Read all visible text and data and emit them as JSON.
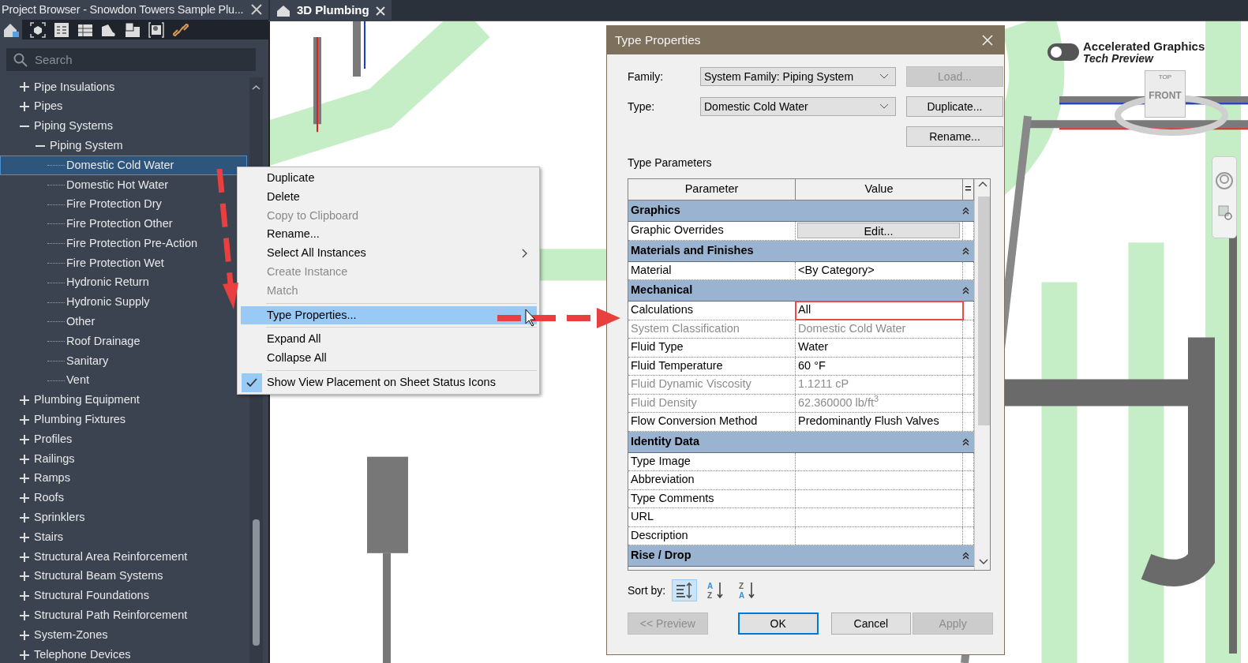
{
  "project_browser": {
    "title": "Project Browser - Snowdon Towers Sample Plu...",
    "search": {
      "placeholder": "Search"
    },
    "tree": [
      {
        "label": "Pipe Insulations",
        "kind": "group",
        "expanded": false,
        "selected": false
      },
      {
        "label": "Pipes",
        "kind": "group",
        "expanded": false,
        "selected": false
      },
      {
        "label": "Piping Systems",
        "kind": "group",
        "expanded": true,
        "selected": false,
        "children": [
          {
            "label": "Piping System",
            "kind": "group",
            "expanded": true,
            "selected": false,
            "children": [
              {
                "label": "Domestic Cold Water",
                "kind": "leaf",
                "selected": true
              },
              {
                "label": "Domestic Hot Water",
                "kind": "leaf",
                "selected": false
              },
              {
                "label": "Fire Protection Dry",
                "kind": "leaf",
                "selected": false
              },
              {
                "label": "Fire Protection Other",
                "kind": "leaf",
                "selected": false
              },
              {
                "label": "Fire Protection Pre-Action",
                "kind": "leaf",
                "selected": false
              },
              {
                "label": "Fire Protection Wet",
                "kind": "leaf",
                "selected": false
              },
              {
                "label": "Hydronic Return",
                "kind": "leaf",
                "selected": false
              },
              {
                "label": "Hydronic Supply",
                "kind": "leaf",
                "selected": false
              },
              {
                "label": "Other",
                "kind": "leaf",
                "selected": false
              },
              {
                "label": "Roof Drainage",
                "kind": "leaf",
                "selected": false
              },
              {
                "label": "Sanitary",
                "kind": "leaf",
                "selected": false
              },
              {
                "label": "Vent",
                "kind": "leaf",
                "selected": false
              }
            ]
          }
        ]
      },
      {
        "label": "Plumbing Equipment",
        "kind": "group",
        "expanded": false,
        "selected": false
      },
      {
        "label": "Plumbing Fixtures",
        "kind": "group",
        "expanded": false,
        "selected": false
      },
      {
        "label": "Profiles",
        "kind": "group",
        "expanded": false,
        "selected": false
      },
      {
        "label": "Railings",
        "kind": "group",
        "expanded": false,
        "selected": false
      },
      {
        "label": "Ramps",
        "kind": "group",
        "expanded": false,
        "selected": false
      },
      {
        "label": "Roofs",
        "kind": "group",
        "expanded": false,
        "selected": false
      },
      {
        "label": "Sprinklers",
        "kind": "group",
        "expanded": false,
        "selected": false
      },
      {
        "label": "Stairs",
        "kind": "group",
        "expanded": false,
        "selected": false
      },
      {
        "label": "Structural Area Reinforcement",
        "kind": "group",
        "expanded": false,
        "selected": false
      },
      {
        "label": "Structural Beam Systems",
        "kind": "group",
        "expanded": false,
        "selected": false
      },
      {
        "label": "Structural Foundations",
        "kind": "group",
        "expanded": false,
        "selected": false
      },
      {
        "label": "Structural Path Reinforcement",
        "kind": "group",
        "expanded": false,
        "selected": false
      },
      {
        "label": "System-Zones",
        "kind": "group",
        "expanded": false,
        "selected": false
      },
      {
        "label": "Telephone Devices",
        "kind": "group",
        "expanded": false,
        "selected": false
      }
    ]
  },
  "view_tabs": [
    {
      "label": "3D Plumbing",
      "selected": true
    }
  ],
  "viewport": {
    "badge_title": "Accelerated Graphics",
    "badge_subtitle": "Tech Preview",
    "view_cube": {
      "top": "TOP",
      "front": "FRONT"
    }
  },
  "context_menu": {
    "items": [
      {
        "kind": "item",
        "label": "Duplicate",
        "disabled": false,
        "selected": false,
        "checked": false,
        "submenu": false
      },
      {
        "kind": "item",
        "label": "Delete",
        "disabled": false,
        "selected": false,
        "checked": false,
        "submenu": false
      },
      {
        "kind": "item",
        "label": "Copy to Clipboard",
        "disabled": true,
        "selected": false,
        "checked": false,
        "submenu": false
      },
      {
        "kind": "item",
        "label": "Rename...",
        "disabled": false,
        "selected": false,
        "checked": false,
        "submenu": false
      },
      {
        "kind": "item",
        "label": "Select All Instances",
        "disabled": false,
        "selected": false,
        "checked": false,
        "submenu": true
      },
      {
        "kind": "item",
        "label": "Create Instance",
        "disabled": true,
        "selected": false,
        "checked": false,
        "submenu": false
      },
      {
        "kind": "item",
        "label": "Match",
        "disabled": true,
        "selected": false,
        "checked": false,
        "submenu": false
      },
      {
        "kind": "separator"
      },
      {
        "kind": "item",
        "label": "Type Properties...",
        "disabled": false,
        "selected": true,
        "checked": false,
        "submenu": false
      },
      {
        "kind": "separator"
      },
      {
        "kind": "item",
        "label": "Expand All",
        "disabled": false,
        "selected": false,
        "checked": false,
        "submenu": false
      },
      {
        "kind": "item",
        "label": "Collapse All",
        "disabled": false,
        "selected": false,
        "checked": false,
        "submenu": false
      },
      {
        "kind": "separator"
      },
      {
        "kind": "item",
        "label": "Show View Placement on Sheet Status Icons",
        "disabled": false,
        "selected": false,
        "checked": true,
        "submenu": false
      }
    ]
  },
  "dialog": {
    "title": "Type Properties",
    "family": {
      "label": "Family:",
      "value": "System Family: Piping System"
    },
    "type": {
      "label": "Type:",
      "value": "Domestic Cold Water"
    },
    "side_buttons": [
      {
        "label": "Load...",
        "disabled": true
      },
      {
        "label": "Duplicate...",
        "disabled": false
      },
      {
        "label": "Rename...",
        "disabled": false
      }
    ],
    "section_label": "Type Parameters",
    "columns": [
      "Parameter",
      "Value",
      "="
    ],
    "groups": [
      {
        "name": "Graphics",
        "expanded": true,
        "rows": [
          {
            "kind": "button",
            "parameter": "Graphic Overrides",
            "value": "Edit...",
            "disabled": false,
            "highlighted": false
          }
        ]
      },
      {
        "name": "Materials and Finishes",
        "expanded": true,
        "rows": [
          {
            "kind": "text",
            "parameter": "Material",
            "value": "<By Category>",
            "disabled": false,
            "highlighted": false
          }
        ]
      },
      {
        "name": "Mechanical",
        "expanded": true,
        "rows": [
          {
            "kind": "text",
            "parameter": "Calculations",
            "value": "All",
            "disabled": false,
            "highlighted": true
          },
          {
            "kind": "text",
            "parameter": "System Classification",
            "value": "Domestic Cold Water",
            "disabled": true,
            "highlighted": false
          },
          {
            "kind": "text",
            "parameter": "Fluid Type",
            "value": "Water",
            "disabled": false,
            "highlighted": false
          },
          {
            "kind": "text",
            "parameter": "Fluid Temperature",
            "value": "60 °F",
            "disabled": false,
            "highlighted": false
          },
          {
            "kind": "text",
            "parameter": "Fluid Dynamic Viscosity",
            "value": "1.1211 cP",
            "disabled": true,
            "highlighted": false
          },
          {
            "kind": "text",
            "parameter": "Fluid Density",
            "value": "62.360000 lb/ft$^{3}$",
            "disabled": true,
            "highlighted": false
          },
          {
            "kind": "text",
            "parameter": "Flow Conversion Method",
            "value": "Predominantly Flush Valves",
            "disabled": false,
            "highlighted": false
          }
        ]
      },
      {
        "name": "Identity Data",
        "expanded": true,
        "rows": [
          {
            "kind": "text",
            "parameter": "Type Image",
            "disabled": false,
            "highlighted": false
          },
          {
            "kind": "text",
            "parameter": "Abbreviation",
            "disabled": false,
            "highlighted": false
          },
          {
            "kind": "text",
            "parameter": "Type Comments",
            "disabled": false,
            "highlighted": false
          },
          {
            "kind": "text",
            "parameter": "URL",
            "disabled": false,
            "highlighted": false
          },
          {
            "kind": "text",
            "parameter": "Description",
            "disabled": false,
            "highlighted": false
          }
        ]
      },
      {
        "name": "Rise / Drop",
        "expanded": true
      }
    ],
    "sort_label": "Sort by:",
    "sort_options": [
      {
        "kind": "grouped",
        "selected": true
      },
      {
        "kind": "ascending",
        "first": "A",
        "second": "Z",
        "selected": false
      },
      {
        "kind": "descending",
        "first": "Z",
        "second": "A",
        "selected": false
      }
    ],
    "footer_buttons": [
      {
        "label": "<< Preview",
        "disabled": true,
        "default": false
      },
      {
        "label": "OK",
        "disabled": false,
        "default": true
      },
      {
        "label": "Cancel",
        "disabled": false,
        "default": false
      },
      {
        "label": "Apply",
        "disabled": true,
        "default": false
      }
    ]
  }
}
